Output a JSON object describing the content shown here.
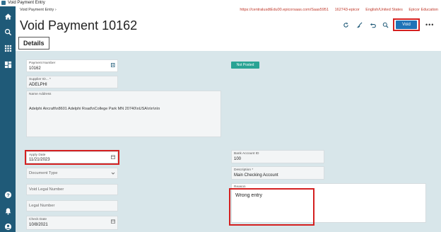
{
  "window": {
    "title": "Void Payment Entry"
  },
  "topbar": {
    "breadcrumb": "Void Payment Entry  ›",
    "env_url": "https://centralusdtEdu00.epicorsaas.com/Saas5951",
    "env_id": "162743-epicor",
    "env_locale": "English/United States",
    "env_name": "Epicor Education"
  },
  "header": {
    "title": "Void Payment 10162",
    "void_label": "Void",
    "more_label": "•••"
  },
  "tabs": {
    "details": "Details"
  },
  "form": {
    "payment_number_label": "Payment Number",
    "payment_number_value": "10162",
    "supplier_id_label": "Supplier ID... *",
    "supplier_id_value": "ADELPHI",
    "name_address_label": "Name Address",
    "name_address_value": "Adelphi Aircraft\\n8601 Adelphi Road\\nCollege Park MN 20740\\nUSA\\n\\n\\n\\n",
    "status_badge": "Not Posted",
    "apply_date_label": "Apply Date",
    "apply_date_value": "11/21/2023",
    "document_type_placeholder": "Document Type",
    "void_legal_number_placeholder": "Void Legal Number",
    "legal_number_placeholder": "Legal Number",
    "check_date_label": "Check Date",
    "check_date_value": "10/8/2021",
    "bank_account_label": "Bank Account ID",
    "bank_account_value": "100",
    "description_label": "Description *",
    "description_value": "Main Checking Account",
    "reason_label": "Reason",
    "reason_value": "Wrong entry"
  },
  "colors": {
    "nav_bg": "#1f5a78",
    "accent": "#1f73b7",
    "highlight": "#d42020",
    "badge": "#29a394",
    "content_bg": "#d8e6ea"
  }
}
